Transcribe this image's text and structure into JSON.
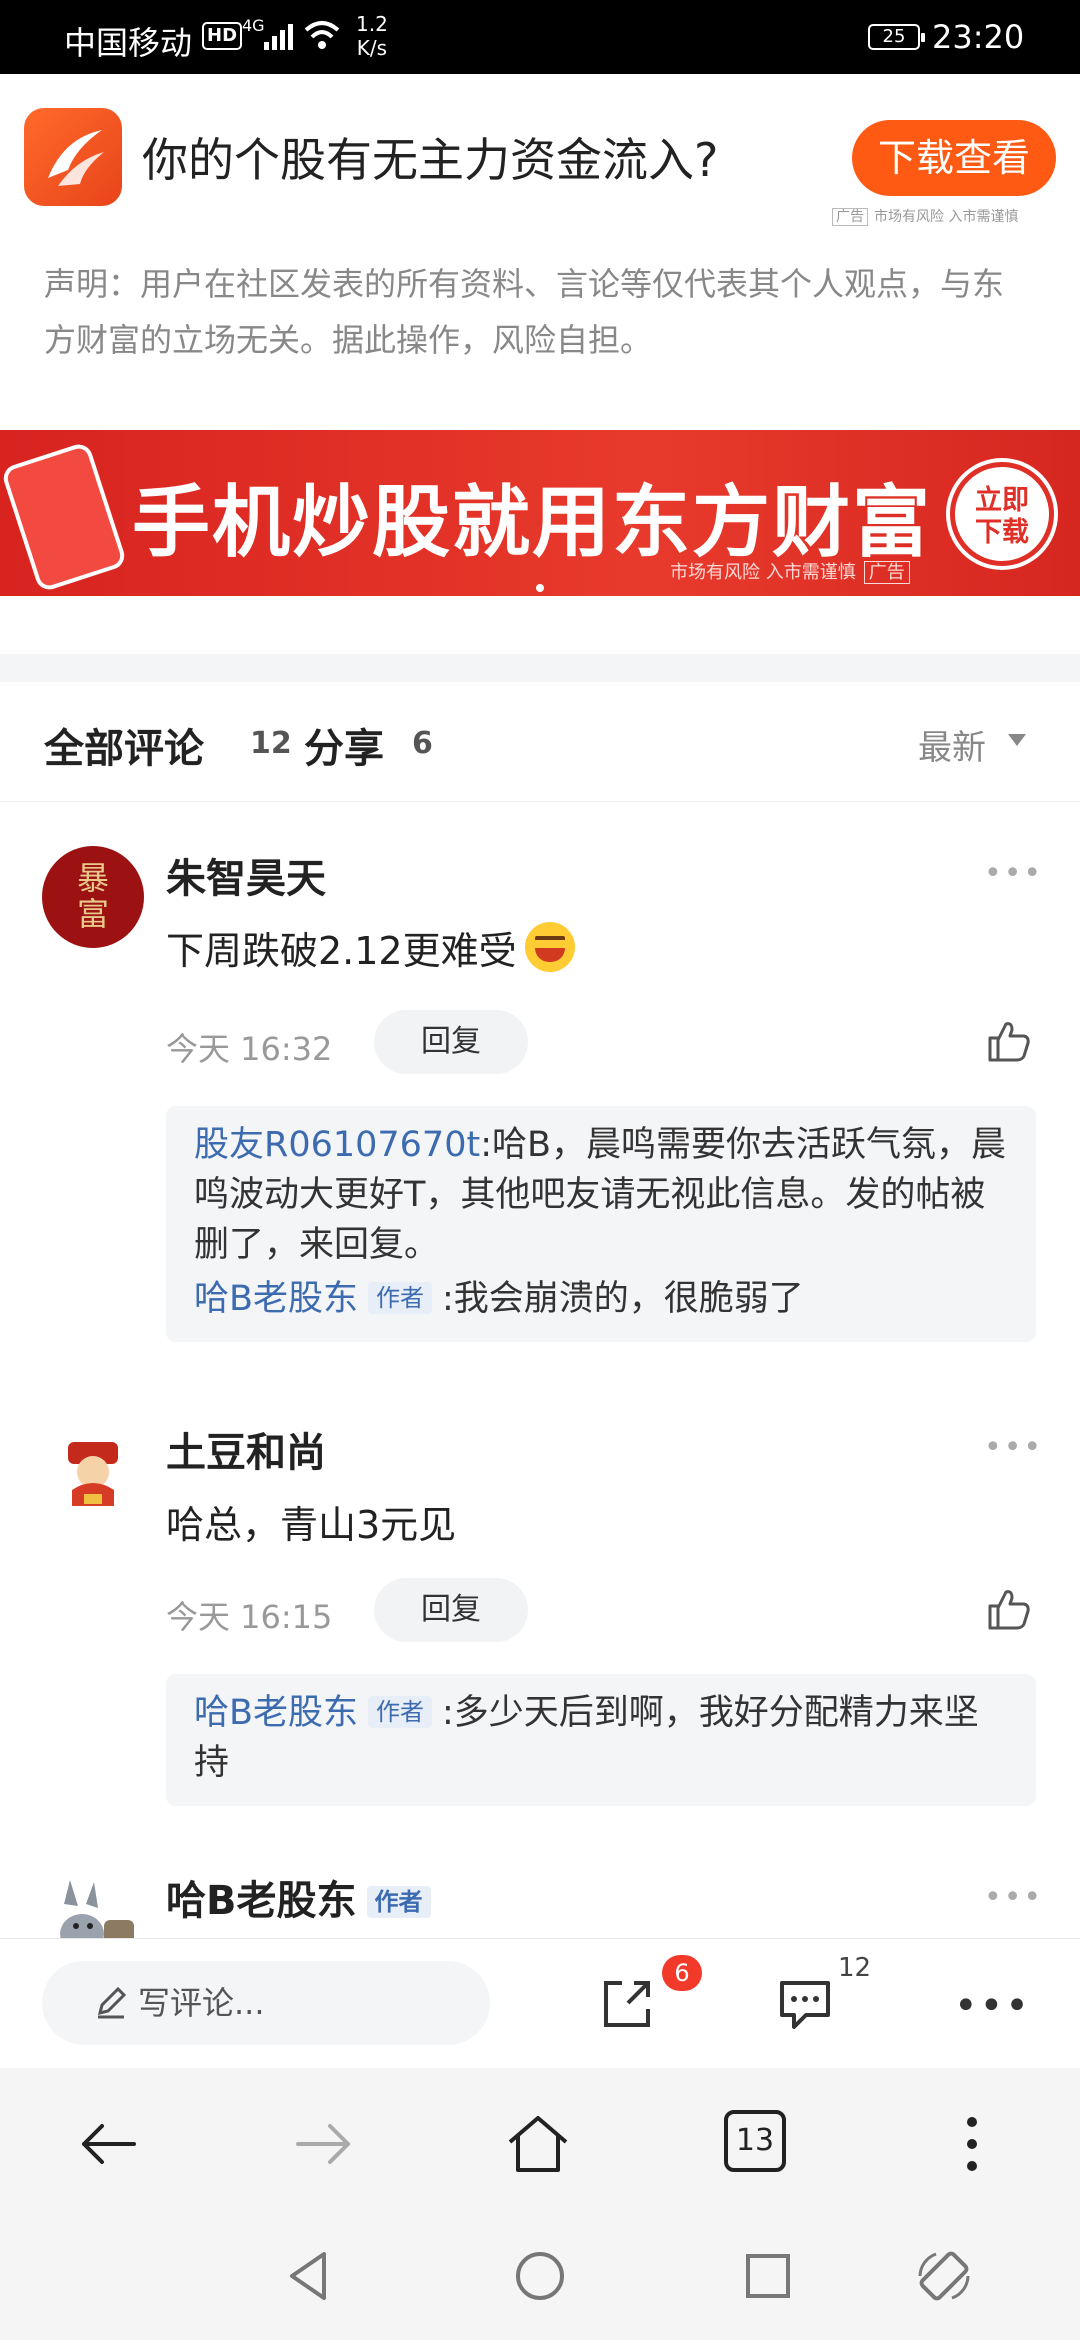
{
  "status_bar": {
    "carrier": "中国移动",
    "hd": "HD",
    "network": "4G",
    "speed_value": "1.2",
    "speed_unit": "K/s",
    "battery": "25",
    "time": "23:20"
  },
  "ad_header": {
    "title": "你的个股有无主力资金流入?",
    "button": "下载查看",
    "ad_label": "广告",
    "risk": "市场有风险 入市需谨慎"
  },
  "disclaimer": "声明：用户在社区发表的所有资料、言论等仅代表其个人观点，与东方财富的立场无关。据此操作，风险自担。",
  "banner": {
    "text": "手机炒股就用东方财富",
    "cta_line1": "立即",
    "cta_line2": "下载",
    "risk": "市场有风险 入市需谨慎",
    "ad_label": "广告"
  },
  "comments_header": {
    "all_label": "全部评论",
    "all_count": "12",
    "share_label": "分享",
    "share_count": "6",
    "sort": "最新"
  },
  "comments": [
    {
      "user": "朱智昊天",
      "avatar_text": "暴富",
      "text": "下周跌破2.12更难受",
      "time": "今天 16:32",
      "reply_label": "回复",
      "replies": [
        {
          "user": "股友R06107670t",
          "text": ":哈B，晨鸣需要你去活跃气氛，晨鸣波动大更好T，其他吧友请无视此信息。发的帖被删了，来回复。"
        },
        {
          "user": "哈B老股东",
          "tag": "作者",
          "text": ":我会崩溃的，很脆弱了"
        }
      ]
    },
    {
      "user": "土豆和尚",
      "text": "哈总，青山3元见",
      "time": "今天 16:15",
      "reply_label": "回复",
      "replies": [
        {
          "user": "哈B老股东",
          "tag": "作者",
          "text": ":多少天后到啊，我好分配精力来坚持"
        }
      ]
    },
    {
      "user": "哈B老股东",
      "tag": "作者"
    }
  ],
  "bottom_bar": {
    "write_placeholder": "写评论...",
    "share_badge": "6",
    "comment_count": "12"
  },
  "browser": {
    "tab_count": "13"
  },
  "colors": {
    "brand_orange": "#ff5a14",
    "banner_red": "#e02f26",
    "link_blue": "#3c6bb0"
  }
}
